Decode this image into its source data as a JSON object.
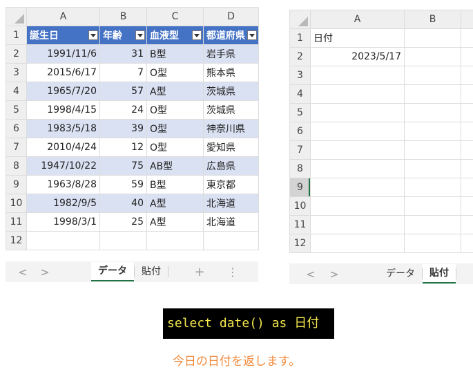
{
  "left_sheet": {
    "columns": [
      "A",
      "B",
      "C",
      "D"
    ],
    "header": [
      "誕生日",
      "年齢",
      "血液型",
      "都道府県"
    ],
    "rows": [
      [
        "1991/11/6",
        "31",
        "B型",
        "岩手県"
      ],
      [
        "2015/6/17",
        "7",
        "O型",
        "熊本県"
      ],
      [
        "1965/7/20",
        "57",
        "A型",
        "茨城県"
      ],
      [
        "1998/4/15",
        "24",
        "O型",
        "茨城県"
      ],
      [
        "1983/5/18",
        "39",
        "O型",
        "神奈川県"
      ],
      [
        "2010/4/24",
        "12",
        "O型",
        "愛知県"
      ],
      [
        "1947/10/22",
        "75",
        "AB型",
        "広島県"
      ],
      [
        "1963/8/28",
        "59",
        "B型",
        "東京都"
      ],
      [
        "1982/9/5",
        "40",
        "A型",
        "北海道"
      ],
      [
        "1998/3/1",
        "25",
        "A型",
        "北海道"
      ]
    ],
    "row_numbers": [
      "1",
      "2",
      "3",
      "4",
      "5",
      "6",
      "7",
      "8",
      "9",
      "10",
      "11",
      "12"
    ],
    "tabs": {
      "prev": "<",
      "next": ">",
      "sheet1": "データ",
      "sheet2": "貼付",
      "add": "+",
      "more": "⋮"
    }
  },
  "right_sheet": {
    "columns": [
      "A",
      "B"
    ],
    "cells": {
      "a1": "日付",
      "a2": "2023/5/17"
    },
    "row_numbers": [
      "1",
      "2",
      "3",
      "4",
      "5",
      "6",
      "7",
      "8",
      "9",
      "10",
      "11",
      "12"
    ],
    "tabs": {
      "prev": "<",
      "next": ">",
      "sheet1": "データ",
      "sheet2": "貼付"
    }
  },
  "code": "select date() as 日付",
  "caption": "今日の日付を返します。"
}
